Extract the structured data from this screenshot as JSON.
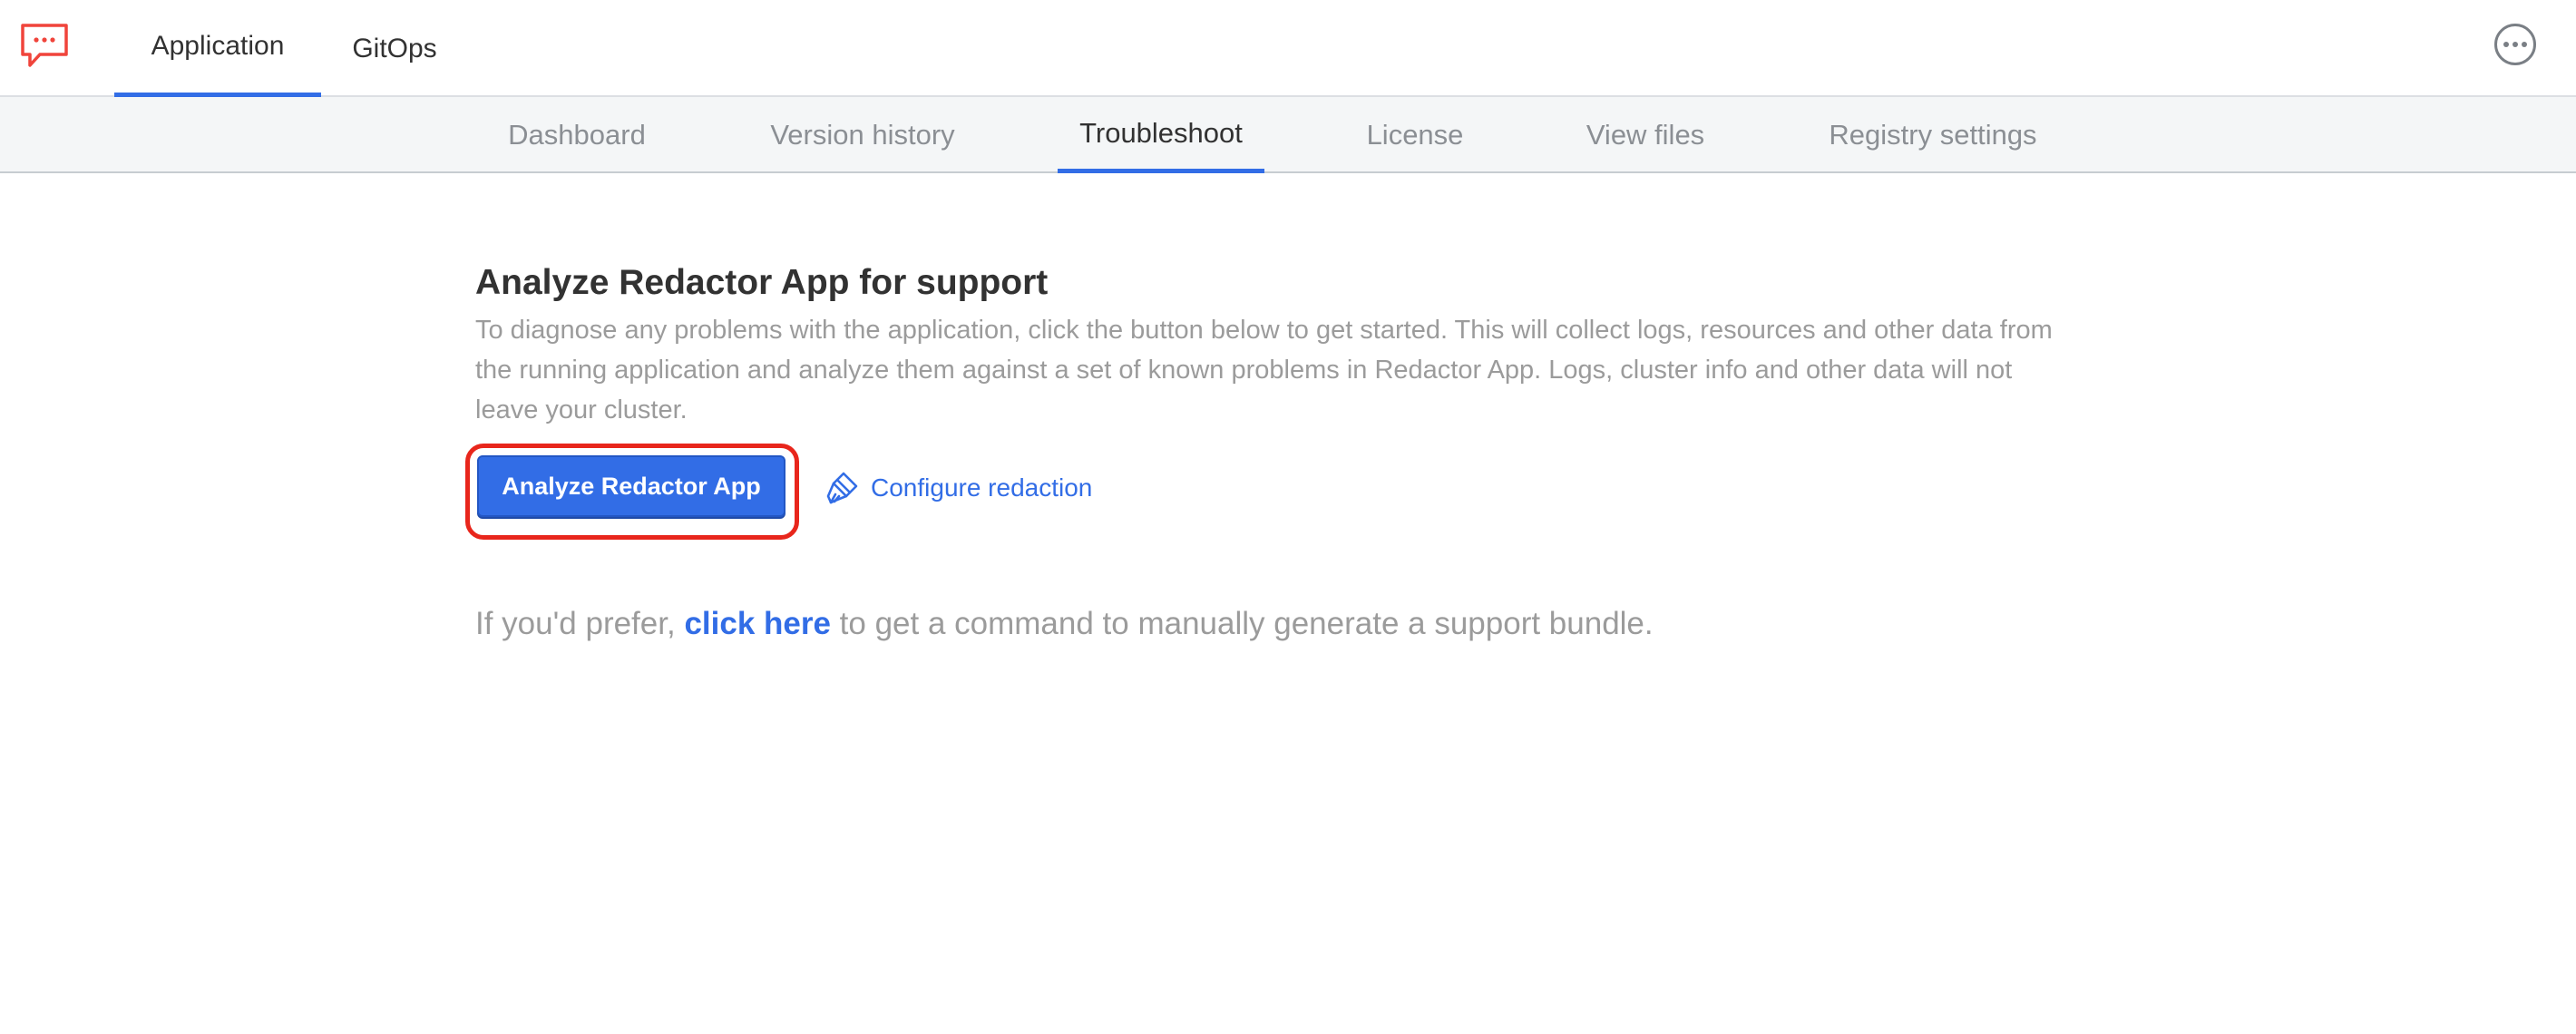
{
  "header": {
    "logo_icon": "chat-bubble-icon",
    "tabs": [
      {
        "label": "Application",
        "active": true
      },
      {
        "label": "GitOps",
        "active": false
      }
    ],
    "menu_icon": "more-horizontal-icon"
  },
  "subnav": {
    "tabs": [
      {
        "label": "Dashboard",
        "active": false
      },
      {
        "label": "Version history",
        "active": false
      },
      {
        "label": "Troubleshoot",
        "active": true
      },
      {
        "label": "License",
        "active": false
      },
      {
        "label": "View files",
        "active": false
      },
      {
        "label": "Registry settings",
        "active": false
      }
    ]
  },
  "main": {
    "title": "Analyze Redactor App for support",
    "description": "To diagnose any problems with the application, click the button below to get started. This will collect logs, resources and other data from the running application and analyze them against a set of known problems in Redactor App. Logs, cluster info and other data will not leave your cluster.",
    "analyze_button_label": "Analyze Redactor App",
    "configure_label": "Configure redaction",
    "configure_icon": "paintbrush-icon",
    "prefer_prefix": "If you'd prefer, ",
    "prefer_link": "click here",
    "prefer_suffix": " to get a command to manually generate a support bundle."
  },
  "colors": {
    "accent": "#326de6",
    "highlight": "#e8261c",
    "logo": "#f0443b"
  }
}
